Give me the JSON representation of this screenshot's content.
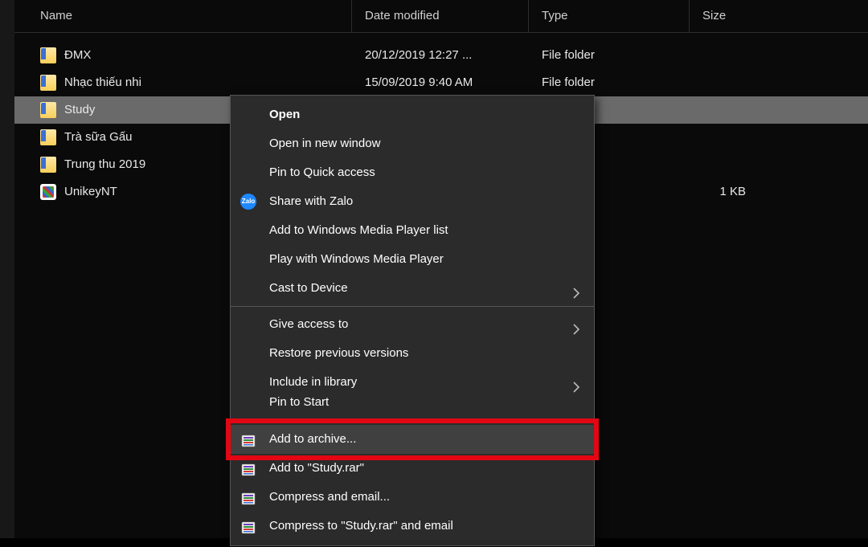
{
  "columns": {
    "name": "Name",
    "date": "Date modified",
    "type": "Type",
    "size": "Size"
  },
  "rows": [
    {
      "icon": "folder",
      "name": "ĐMX",
      "date": "20/12/2019 12:27 ...",
      "type": "File folder",
      "size": ""
    },
    {
      "icon": "folder",
      "name": "Nhạc thiếu nhi",
      "date": "15/09/2019 9:40 AM",
      "type": "File folder",
      "size": ""
    },
    {
      "icon": "folder",
      "name": "Study",
      "date": "",
      "type": "",
      "size": "",
      "selected": true
    },
    {
      "icon": "folder",
      "name": "Trà sữa Gấu",
      "date": "",
      "type": "",
      "size": ""
    },
    {
      "icon": "folder",
      "name": "Trung thu 2019",
      "date": "",
      "type": "",
      "size": ""
    },
    {
      "icon": "unikey",
      "name": "UnikeyNT",
      "date": "",
      "type": "",
      "size": "1 KB"
    }
  ],
  "menu": {
    "groups": [
      [
        {
          "label": "Open",
          "bold": true
        },
        {
          "label": "Open in new window"
        },
        {
          "label": "Pin to Quick access"
        },
        {
          "label": "Share with Zalo",
          "icon": "zalo"
        },
        {
          "label": "Add to Windows Media Player list"
        },
        {
          "label": "Play with Windows Media Player"
        },
        {
          "label": "Cast to Device",
          "arrow": true
        }
      ],
      [
        {
          "label": "Give access to",
          "arrow": true
        },
        {
          "label": "Restore previous versions"
        },
        {
          "label": "Include in library",
          "arrow": true
        },
        {
          "label": "Pin to Start",
          "cut": true
        }
      ],
      [
        {
          "label": "Add to archive...",
          "icon": "rar",
          "hover": true,
          "highlight": true
        },
        {
          "label": "Add to \"Study.rar\"",
          "icon": "rar"
        },
        {
          "label": "Compress and email...",
          "icon": "rar"
        },
        {
          "label": "Compress to \"Study.rar\" and email",
          "icon": "rar"
        }
      ]
    ]
  }
}
